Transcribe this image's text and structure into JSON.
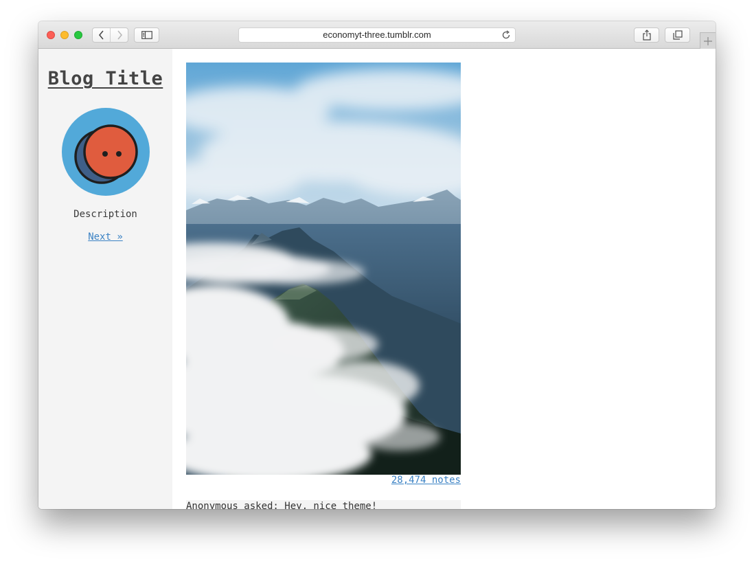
{
  "browser": {
    "url": "economyt-three.tumblr.com",
    "icons": {
      "back": "chevron-left-icon",
      "forward": "chevron-right-icon",
      "sidebar": "sidebar-icon",
      "reload": "reload-icon",
      "share": "share-icon",
      "tabs": "tabs-icon",
      "new_tab": "plus-icon"
    }
  },
  "sidebar": {
    "blog_title": "Blog Title",
    "description": "Description",
    "next_link": "Next »",
    "avatar": {
      "icon": "smiley-avatar-icon",
      "bg_color": "#52a9d9",
      "face_color": "#e05c3e"
    }
  },
  "post": {
    "photo": {
      "description_icon": "mountain-clouds-photo"
    },
    "notes": "28,474 notes"
  },
  "ask": {
    "text": "Anonymous asked: Hey, nice theme!"
  },
  "colors": {
    "link": "#3b82c4",
    "sidebar_bg": "#f4f4f4"
  }
}
